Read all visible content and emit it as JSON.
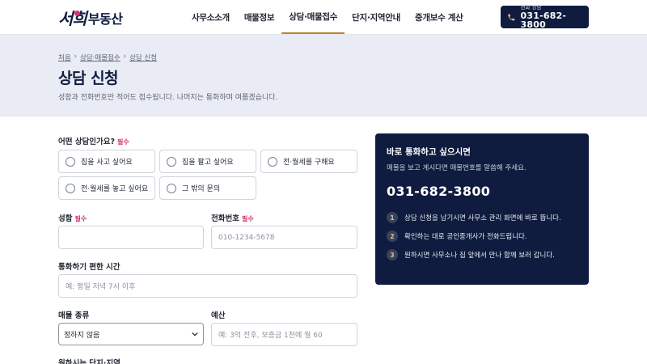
{
  "header": {
    "logo_main": "서희",
    "logo_sub": "부동산",
    "nav": [
      {
        "label": "사무소소개"
      },
      {
        "label": "매물정보"
      },
      {
        "label": "상담·매물접수"
      },
      {
        "label": "단지·지역안내"
      },
      {
        "label": "중개보수 계산"
      }
    ],
    "active_nav": "상담·매물접수",
    "call": {
      "small": "전화 상담",
      "number": "031-682-3800",
      "icon": "phone-icon"
    }
  },
  "hero": {
    "breadcrumb": [
      "처음",
      "상담·매물접수",
      "상담 신청"
    ],
    "title": "상담 신청",
    "description": "성함과 전화번호만 적어도 접수됩니다. 나머지는 통화하며 여쭙겠습니다."
  },
  "form": {
    "type_label": "어떤 상담인가요?",
    "required": "필수",
    "options": [
      {
        "label": "집을 사고 싶어요"
      },
      {
        "label": "집을 팔고 싶어요"
      },
      {
        "label": "전·월세를 구해요"
      },
      {
        "label": "전·월세를 놓고 싶어요"
      },
      {
        "label": "그 밖의 문의"
      }
    ],
    "name_label": "성함",
    "phone_label": "전화번호",
    "phone_placeholder": "010-1234-5678",
    "time_label": "통화하기 편한 시간",
    "time_placeholder": "예: 평일 저녁 7시 이후",
    "property_label": "매물 종류",
    "property_value": "정하지 않음",
    "budget_label": "예산",
    "budget_placeholder": "예: 3억 전후, 보증금 1천에 월 60",
    "complex_label": "원하시는 단지·지역"
  },
  "card": {
    "title": "바로 통화하고 싶으시면",
    "subtitle": "매물을 보고 계시다면 매물번호를 말씀해 주세요.",
    "phone": "031-682-3800",
    "steps": [
      {
        "num": "1",
        "text": "상담 신청을 남기시면 사무소 관리 화면에 바로 뜹니다."
      },
      {
        "num": "2",
        "text": "확인하는 대로 공인중개사가 전화드립니다."
      },
      {
        "num": "3",
        "text": "원하시면 사무소나 집 앞에서 만나 함께 보러 갑니다."
      }
    ]
  },
  "colors": {
    "navy": "#0f1c3f",
    "accent_gold": "#b8862b",
    "required_red": "#d6336c",
    "hero_bg": "#e9ecf5"
  }
}
